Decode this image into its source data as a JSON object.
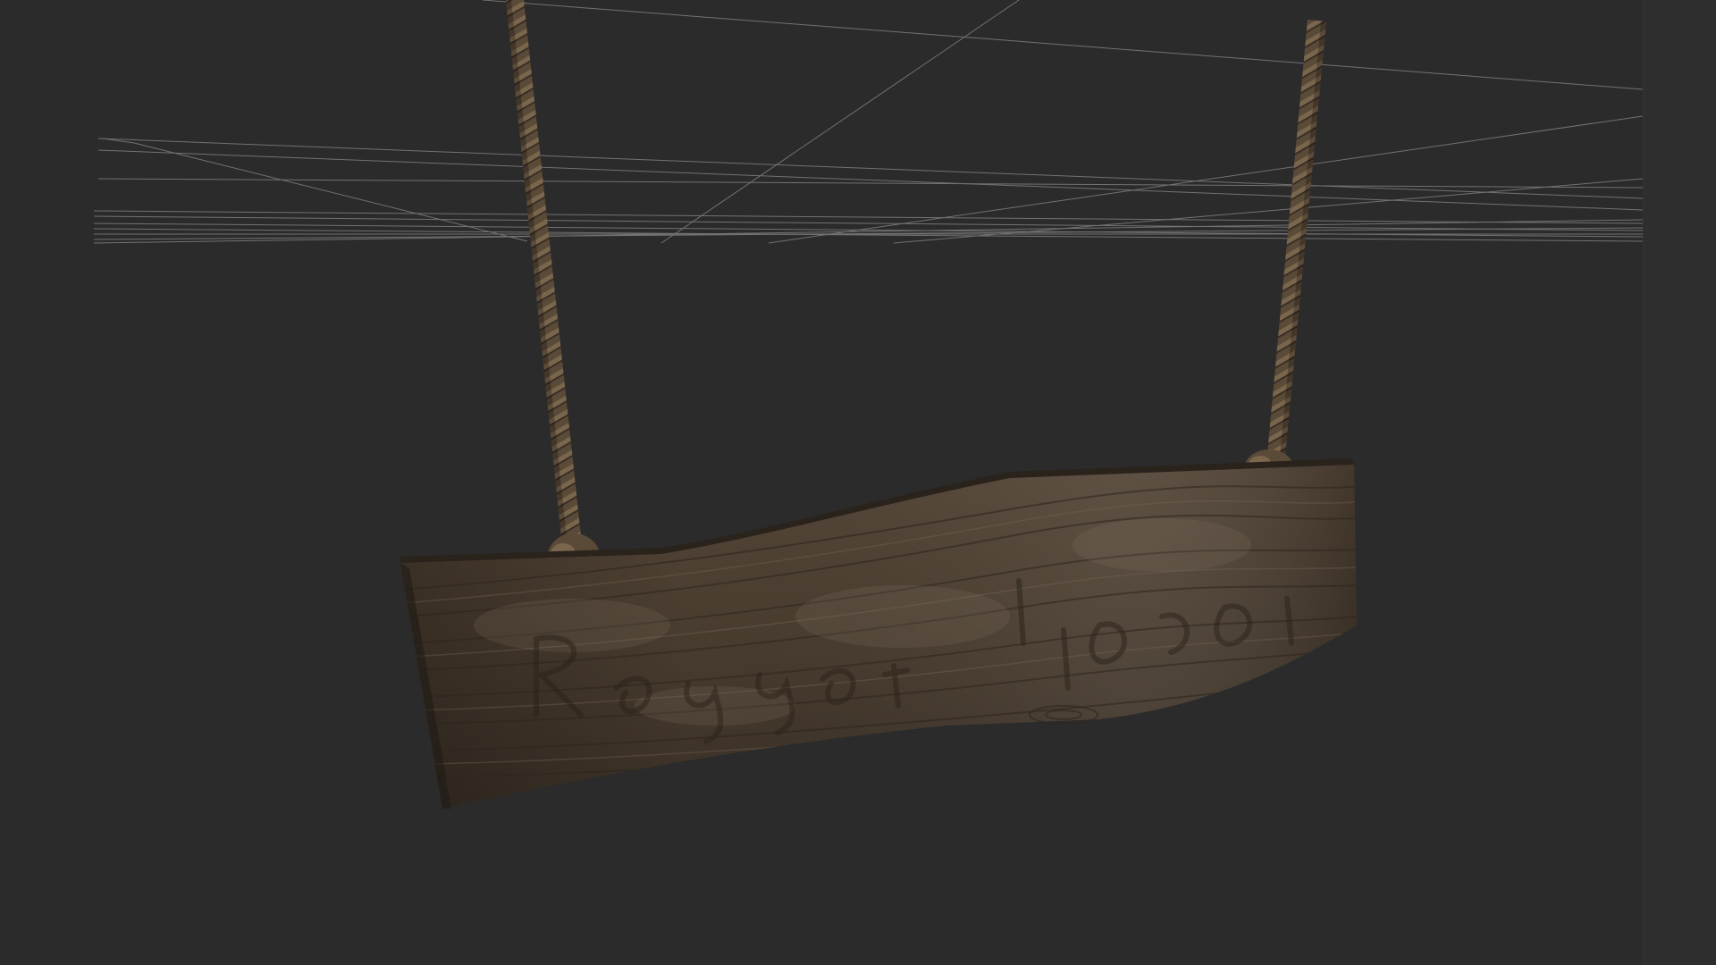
{
  "viewport": {
    "background_color": "#2b2b2b",
    "strip_color": "#2e2e2e",
    "wireframe_color": "#8a8a8a"
  },
  "scene": {
    "object": "hanging-wooden-sign",
    "wood_colors": {
      "base": "#4a3d30",
      "light": "#6b5b4a",
      "dark": "#2f2720"
    },
    "rope_color": "#5a4a38",
    "rope_highlight": "#7a664d",
    "carved_text_visible": true
  }
}
